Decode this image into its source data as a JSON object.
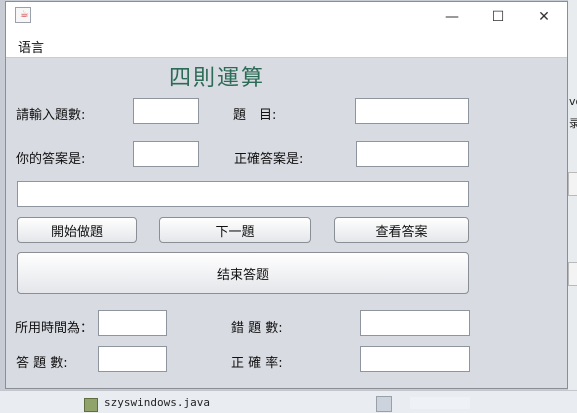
{
  "window": {
    "minimize": "—",
    "maximize": "☐",
    "close": "✕"
  },
  "menu": {
    "language": "语言"
  },
  "app_title": "四則運算",
  "labels": {
    "question_count": "請輸入題數:",
    "question": "題　目:",
    "your_answer": "你的答案是:",
    "correct_answer": "正確答案是:",
    "time_used": "所用時間為：",
    "wrong_count": "錯 題 數:",
    "answered_count": "答 題 數:",
    "accuracy": "正 確 率:"
  },
  "fields": {
    "question_count": "",
    "question": "",
    "your_answer": "",
    "correct_answer": "",
    "message": "",
    "time_used": "",
    "wrong_count": "",
    "answered_count": "",
    "accuracy": ""
  },
  "buttons": {
    "start": "開始做題",
    "next": "下一題",
    "view_answer": "查看答案",
    "finish": "结束答题"
  },
  "background": {
    "file_name": "szyswindows.java",
    "edge_fragment_1": "vo",
    "edge_fragment_2": "录"
  }
}
